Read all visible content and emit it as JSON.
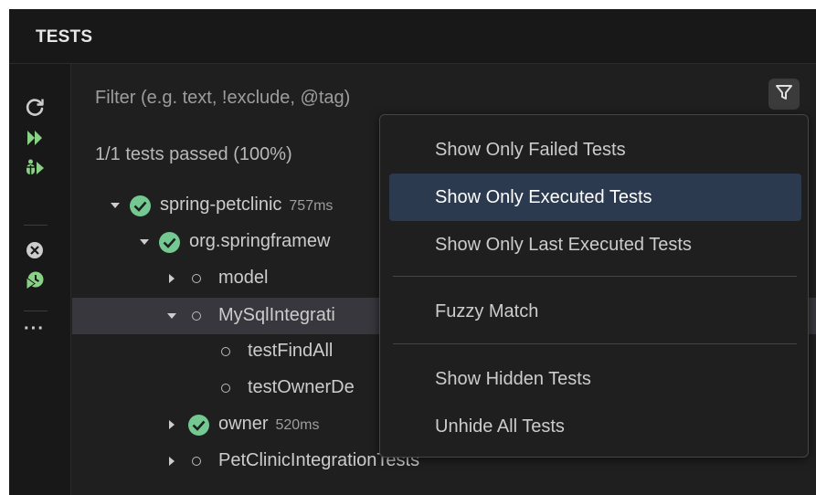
{
  "header": {
    "title": "TESTS"
  },
  "toolbar": {
    "icons": [
      "refresh-icon",
      "run-all-icon",
      "debug-all-icon",
      "cancel-icon",
      "coverage-icon"
    ],
    "more_label": "···"
  },
  "filter": {
    "placeholder": "Filter (e.g. text, !exclude, @tag)",
    "filter_icon": "funnel-icon"
  },
  "summary": "1/1 tests passed (100%)",
  "tree": [
    {
      "label": "spring-petclinic",
      "duration": "757ms",
      "status": "passed",
      "expanded": true
    },
    {
      "label": "org.springframew",
      "duration": "",
      "status": "passed",
      "expanded": true
    },
    {
      "label": "model",
      "duration": "",
      "status": "none",
      "expanded": false
    },
    {
      "label": "MySqlIntegrati",
      "duration": "",
      "status": "none",
      "expanded": true,
      "selected": true
    },
    {
      "label": "testFindAll",
      "duration": "",
      "status": "none"
    },
    {
      "label": "testOwnerDe",
      "duration": "",
      "status": "none"
    },
    {
      "label": "owner",
      "duration": "520ms",
      "status": "passed",
      "expanded": false
    },
    {
      "label": "PetClinicIntegrationTests",
      "duration": "",
      "status": "none",
      "expanded": false
    }
  ],
  "menu": {
    "items": [
      {
        "label": "Show Only Failed Tests"
      },
      {
        "label": "Show Only Executed Tests",
        "active": true
      },
      {
        "label": "Show Only Last Executed Tests"
      },
      {
        "label": "Fuzzy Match"
      },
      {
        "label": "Show Hidden Tests"
      },
      {
        "label": "Unhide All Tests"
      }
    ]
  },
  "colors": {
    "passed": "#73c991",
    "run": "#89d185",
    "background": "#1f1f1f",
    "menu_active": "#2c3a4f",
    "selected_row": "#37373d"
  }
}
